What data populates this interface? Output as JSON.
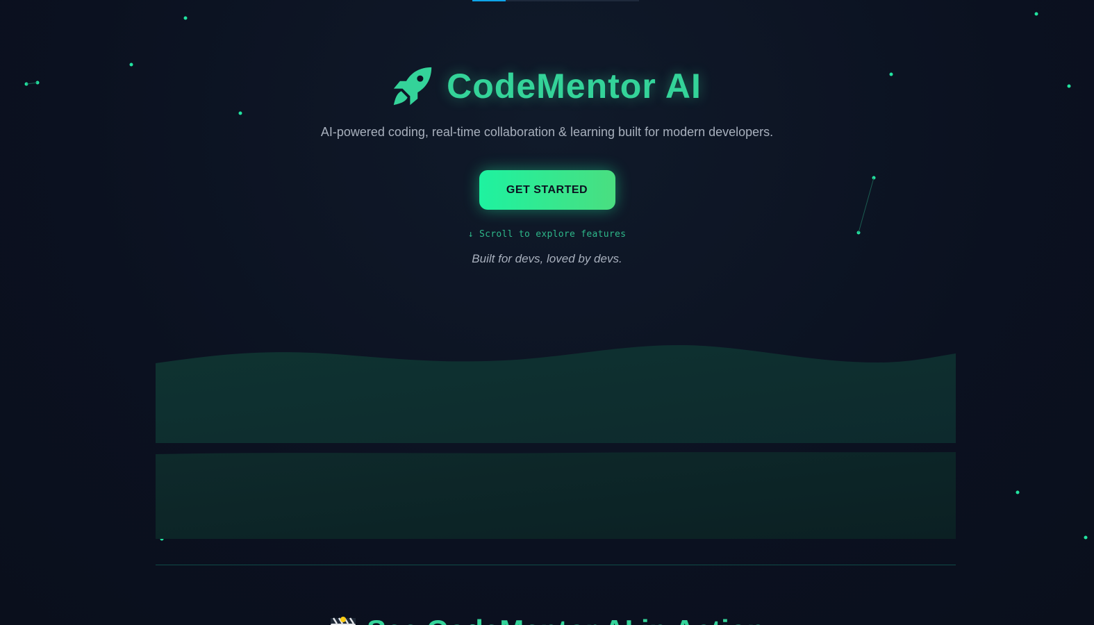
{
  "hero": {
    "title": "CodeMentor AI",
    "icon": "rocket-icon",
    "tagline": "AI-powered coding, real-time collaboration & learning built for modern developers.",
    "cta_label": "GET STARTED",
    "scroll_hint": "↓ Scroll to explore features",
    "built_for": "Built for devs, loved by devs."
  },
  "next_section": {
    "title": "See CodeMentor AI in Action",
    "icon": "clapperboard-icon"
  },
  "colors": {
    "background": "#0b1120",
    "accent": "#34d399",
    "cta_start": "#1ef2a0",
    "cta_end": "#4ade80",
    "muted_text": "#a8b0bd",
    "wave_top": "#0f2f30",
    "wave_bottom": "#0c2426"
  }
}
